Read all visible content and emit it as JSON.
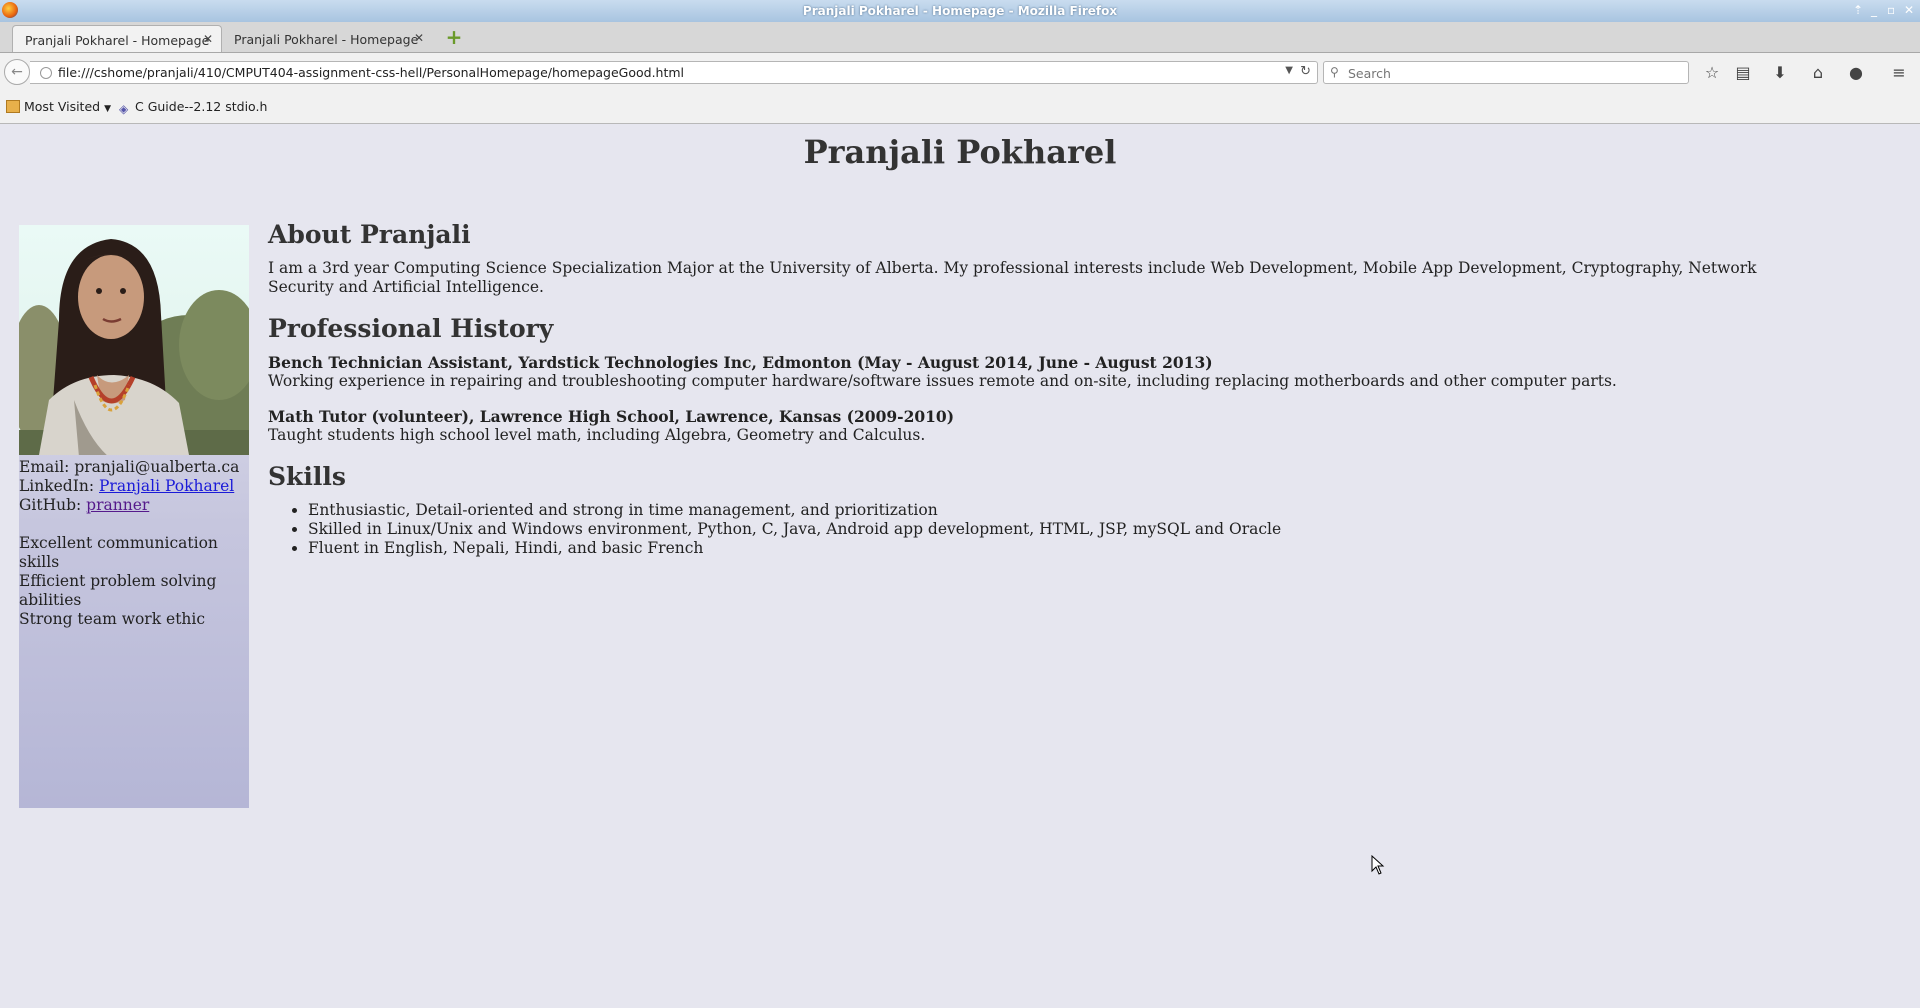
{
  "window": {
    "title": "Pranjali Pokharel - Homepage - Mozilla Firefox"
  },
  "tabs": [
    {
      "label": "Pranjali Pokharel - Homepage",
      "active": true
    },
    {
      "label": "Pranjali Pokharel - Homepage",
      "active": false
    }
  ],
  "navbar": {
    "url": "file:///cshome/pranjali/410/CMPUT404-assignment-css-hell/PersonalHomepage/homepageGood.html",
    "search_placeholder": "Search"
  },
  "bookmarks": [
    {
      "label": "Most Visited"
    },
    {
      "label": "C Guide--2.12 stdio.h"
    }
  ],
  "page": {
    "name": "Pranjali Pokharel",
    "sidebar": {
      "email": "Email: pranjali@ualberta.ca",
      "linkedin_label": "LinkedIn:",
      "linkedin_link": "Pranjali Pokharel",
      "github_label": "GitHub:",
      "github_link": "pranner",
      "traits": [
        "Excellent communication skills",
        "Efficient problem solving abilities",
        "Strong team work ethic"
      ]
    },
    "about": {
      "heading": "About Pranjali",
      "text": "I am a 3rd year Computing Science Specialization Major at the University of Alberta. My professional interests include Web Development, Mobile App Development, Cryptography, Network Security and Artificial Intelligence."
    },
    "history": {
      "heading": "Professional History",
      "jobs": [
        {
          "title": "Bench Technician Assistant, Yardstick Technologies Inc, Edmonton (May - August 2014, June - August 2013)",
          "desc": "Working experience in repairing and troubleshooting computer hardware/software issues remote and on-site, including replacing motherboards and other computer parts."
        },
        {
          "title": "Math Tutor (volunteer), Lawrence High School, Lawrence, Kansas (2009-2010)",
          "desc": "Taught students high school level math, including Algebra, Geometry and Calculus."
        }
      ]
    },
    "skills": {
      "heading": "Skills",
      "items": [
        "Enthusiastic, Detail-oriented and strong in time management, and prioritization",
        "Skilled in Linux/Unix and Windows environment, Python, C, Java, Android app development, HTML, JSP, mySQL and Oracle",
        "Fluent in English, Nepali, Hindi, and basic French"
      ]
    }
  },
  "colors": {
    "page_bg": "#e6e6ef",
    "sidebar_bottom": "#b5b6d6",
    "link": "#1a1ad8",
    "visited_link": "#551a8b"
  }
}
